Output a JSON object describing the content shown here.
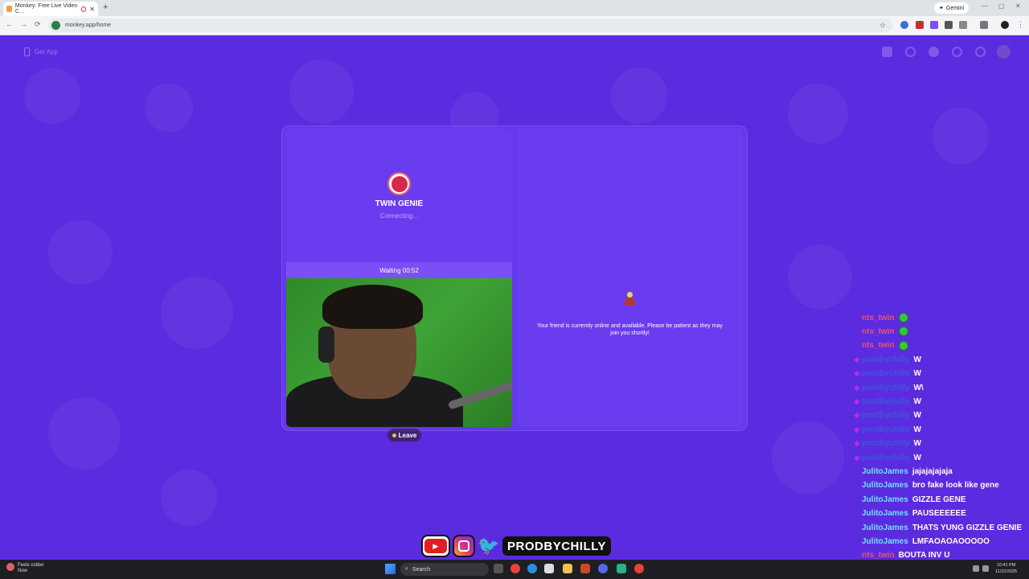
{
  "browser": {
    "tab_title": "Monkey: Free Live Video C…",
    "new_tab": "+",
    "gemini_label": "Gemini",
    "url": "monkey.app/home",
    "back": "←",
    "forward": "→",
    "reload": "⟳",
    "star": "☆"
  },
  "header": {
    "get_app": "Get App"
  },
  "left_panel": {
    "peer_name": "TWIN GENIE",
    "status": "Connecting...",
    "waiting": "Waiting 00:52",
    "leave": "Leave"
  },
  "right_panel": {
    "message": "Your friend is currently online and available. Please be patient as they may join you shortly!"
  },
  "chat": [
    {
      "user": "nts_twin",
      "msg": "",
      "emote": true,
      "color": "#f0506a",
      "badge": false
    },
    {
      "user": "nts_twin",
      "msg": "",
      "emote": true,
      "color": "#f0506a",
      "badge": false
    },
    {
      "user": "nts_twin",
      "msg": "",
      "emote": true,
      "color": "#f0506a",
      "badge": false
    },
    {
      "user": "prodbychilly",
      "msg": "W",
      "emote": false,
      "color": "#3a5ad8",
      "badge": true
    },
    {
      "user": "prodbychilly",
      "msg": "W",
      "emote": false,
      "color": "#3a5ad8",
      "badge": true
    },
    {
      "user": "prodbychilly",
      "msg": "W\\",
      "emote": false,
      "color": "#3a5ad8",
      "badge": true
    },
    {
      "user": "prodbychilly",
      "msg": "W",
      "emote": false,
      "color": "#3a5ad8",
      "badge": true
    },
    {
      "user": "prodbychilly",
      "msg": "W",
      "emote": false,
      "color": "#3a5ad8",
      "badge": true
    },
    {
      "user": "prodbychilly",
      "msg": "W",
      "emote": false,
      "color": "#3a5ad8",
      "badge": true
    },
    {
      "user": "prodbychilly",
      "msg": "W",
      "emote": false,
      "color": "#3a5ad8",
      "badge": true
    },
    {
      "user": "prodbychilly",
      "msg": "W",
      "emote": false,
      "color": "#3a5ad8",
      "badge": true
    },
    {
      "user": "JulitoJames",
      "msg": "jajajajajaja",
      "emote": false,
      "color": "#6fe0ff",
      "badge": false
    },
    {
      "user": "JulitoJames",
      "msg": "bro fake look like gene",
      "emote": false,
      "color": "#6fe0ff",
      "badge": false
    },
    {
      "user": "JulitoJames",
      "msg": "GIZZLE GENE",
      "emote": false,
      "color": "#6fe0ff",
      "badge": false
    },
    {
      "user": "JulitoJames",
      "msg": "PAUSEEEEEE",
      "emote": false,
      "color": "#6fe0ff",
      "badge": false
    },
    {
      "user": "JulitoJames",
      "msg": "THATS YUNG GIZZLE GENIE",
      "emote": false,
      "color": "#6fe0ff",
      "badge": false
    },
    {
      "user": "JulitoJames",
      "msg": "LMFAOAOAOOOOO",
      "emote": false,
      "color": "#6fe0ff",
      "badge": false
    },
    {
      "user": "nts_twin",
      "msg": "BOUTA INV U",
      "emote": false,
      "color": "#f0506a",
      "badge": false
    }
  ],
  "social": {
    "youtube_icon": "youtube-icon",
    "instagram_icon": "instagram-icon",
    "twitter_icon": "twitter-icon",
    "handle": "PRODBYCHILLY"
  },
  "taskbar": {
    "weather_title": "Feels colder",
    "weather_sub": "Now",
    "search_label": "Search",
    "time": "10:41 PM",
    "date": "11/22/2025"
  }
}
